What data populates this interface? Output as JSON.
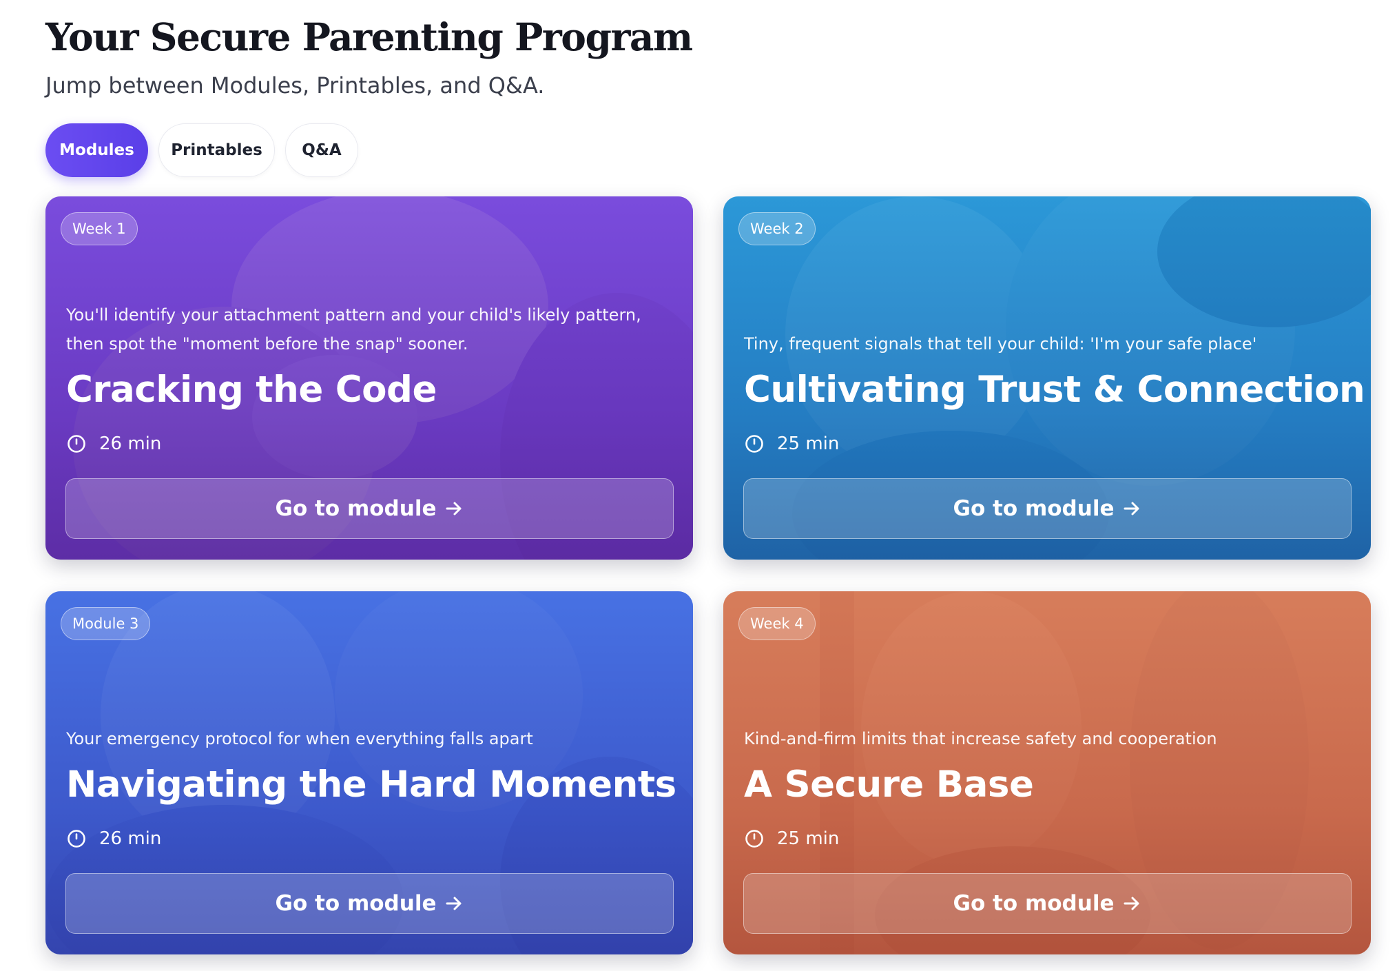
{
  "header": {
    "title": "Your Secure Parenting Program",
    "subtitle": "Jump between Modules, Printables, and Q&A."
  },
  "tabs": [
    {
      "label": "Modules",
      "active": true
    },
    {
      "label": "Printables",
      "active": false
    },
    {
      "label": "Q&A",
      "active": false
    }
  ],
  "cards": [
    {
      "badge": "Week 1",
      "description": "You'll identify your attachment pattern and your child's likely pattern, then spot the \"moment before the snap\" sooner.",
      "title": "Cracking the Code",
      "duration": "26 min",
      "button_label": "Go to module",
      "button_icon": "arrow-right-icon",
      "meta_icon": "clock-icon",
      "accent": "#6a3fd6"
    },
    {
      "badge": "Week 2",
      "description": "Tiny, frequent signals that tell your child: 'I'm your safe place'",
      "title": "Cultivating Trust & Connection",
      "duration": "25 min",
      "button_label": "Go to module",
      "button_icon": "arrow-right-icon",
      "meta_icon": "clock-icon",
      "accent": "#2286c8"
    },
    {
      "badge": "Module 3",
      "description": "Your emergency protocol for when everything falls apart",
      "title": "Navigating the Hard Moments",
      "duration": "26 min",
      "button_label": "Go to module",
      "button_icon": "arrow-right-icon",
      "meta_icon": "clock-icon",
      "accent": "#3f5ad6"
    },
    {
      "badge": "Week 4",
      "description": "Kind-and-firm limits that increase safety and cooperation",
      "title": "A Secure Base",
      "duration": "25 min",
      "button_label": "Go to module",
      "button_icon": "arrow-right-icon",
      "meta_icon": "clock-icon",
      "accent": "#c86a4e"
    }
  ],
  "colors": {
    "primary": "#5a3fe8",
    "heading": "#14161f"
  }
}
